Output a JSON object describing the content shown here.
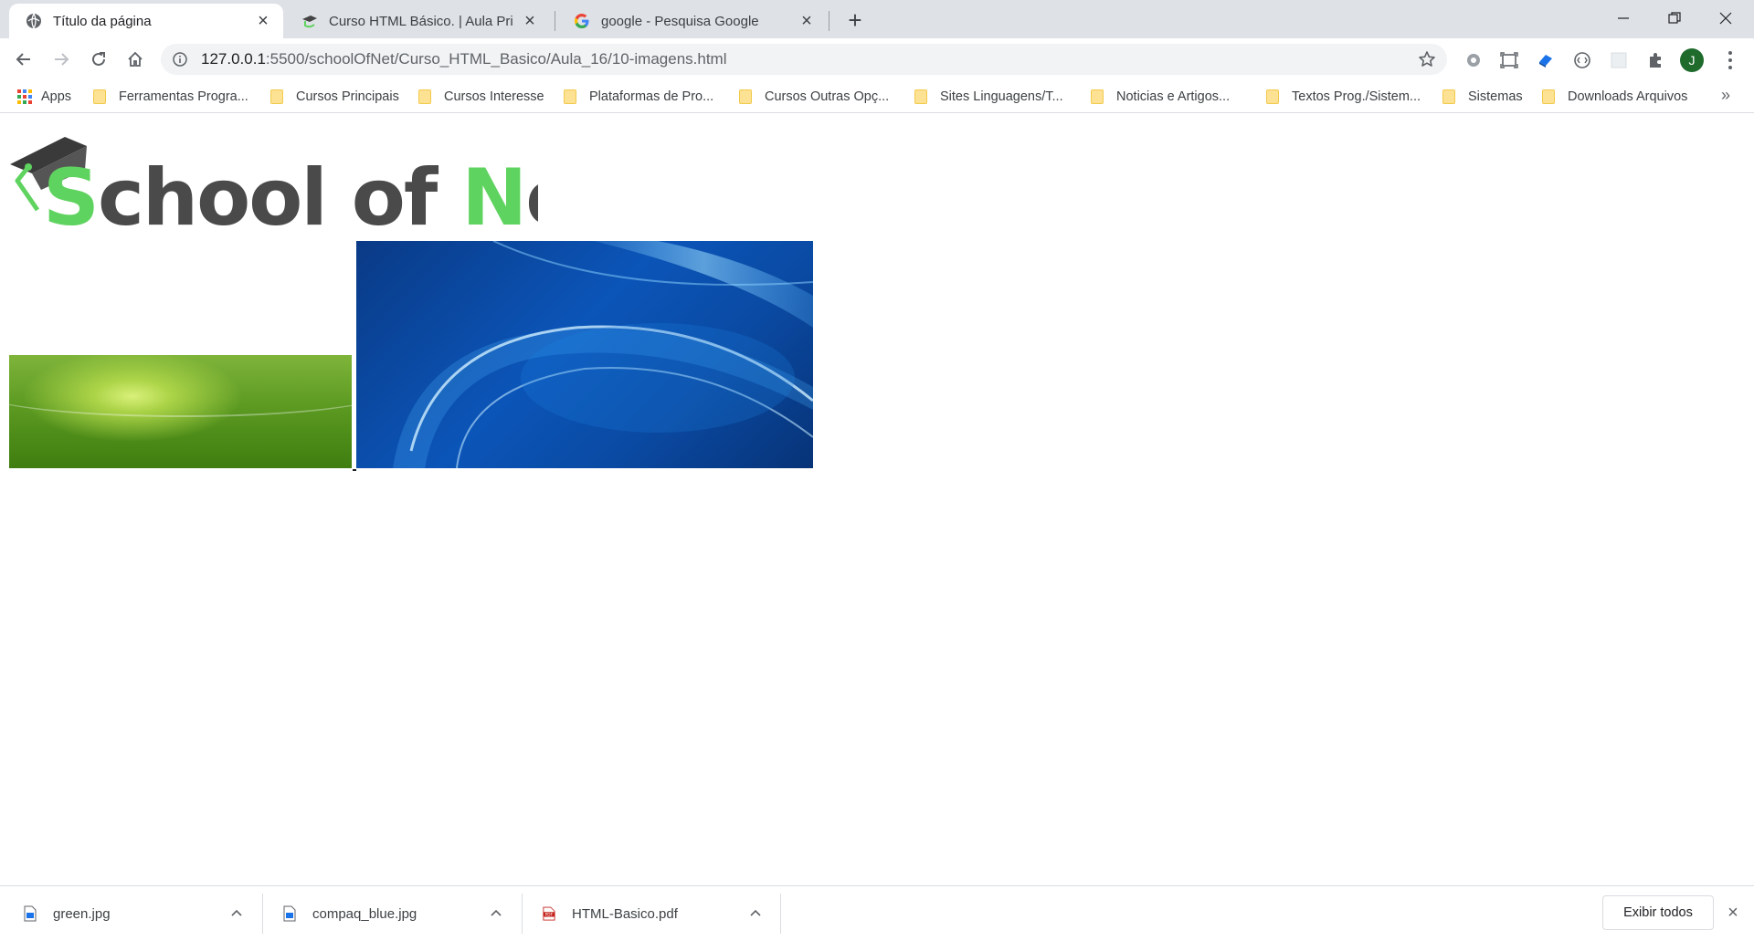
{
  "tabs": [
    {
      "title": "Título da página",
      "icon": "globe-icon",
      "active": true
    },
    {
      "title": "Curso HTML Básico. | Aula Primeir",
      "icon": "schoolofnet-icon",
      "active": false
    },
    {
      "title": "google - Pesquisa Google",
      "icon": "google-icon",
      "active": false
    }
  ],
  "new_tab_label": "+",
  "address": {
    "host": "127.0.0.1",
    "path": ":5500/schoolOfNet/Curso_HTML_Basico/Aula_16/10-imagens.html"
  },
  "profile": {
    "initial": "J",
    "color": "#1e6b2c"
  },
  "bookmarks": [
    {
      "label": "Apps",
      "icon": "apps-grid-icon"
    },
    {
      "label": "Ferramentas Progra...",
      "icon": "folder-icon"
    },
    {
      "label": "Cursos Principais",
      "icon": "folder-icon"
    },
    {
      "label": "Cursos Interesse",
      "icon": "folder-icon"
    },
    {
      "label": "Plataformas de Pro...",
      "icon": "folder-icon"
    },
    {
      "label": "Cursos Outras Opç...",
      "icon": "folder-icon"
    },
    {
      "label": "Sites Linguagens/T...",
      "icon": "folder-icon"
    },
    {
      "label": "Noticias e Artigos...",
      "icon": "folder-icon"
    },
    {
      "label": "Textos Prog./Sistem...",
      "icon": "folder-icon"
    },
    {
      "label": "Sistemas",
      "icon": "folder-icon"
    },
    {
      "label": "Downloads Arquivos",
      "icon": "folder-icon"
    }
  ],
  "bookmarks_overflow": "»",
  "page": {
    "logo": {
      "word_1": "School",
      "word_2": "of",
      "word_3": "Net"
    },
    "images": [
      {
        "name": "green-image",
        "colors": [
          "#7fb43a",
          "#3f7d10"
        ]
      },
      {
        "name": "blue-image",
        "colors": [
          "#0b55b8",
          "#073377"
        ]
      }
    ]
  },
  "downloads": [
    {
      "filename": "green.jpg",
      "icon": "image-file-icon"
    },
    {
      "filename": "compaq_blue.jpg",
      "icon": "image-file-icon"
    },
    {
      "filename": "HTML-Basico.pdf",
      "icon": "pdf-file-icon"
    }
  ],
  "downloads_show_all": "Exibir todos",
  "accent_colors": {
    "school_green": "#5fd35f",
    "logo_dark": "#4a4a4a"
  }
}
